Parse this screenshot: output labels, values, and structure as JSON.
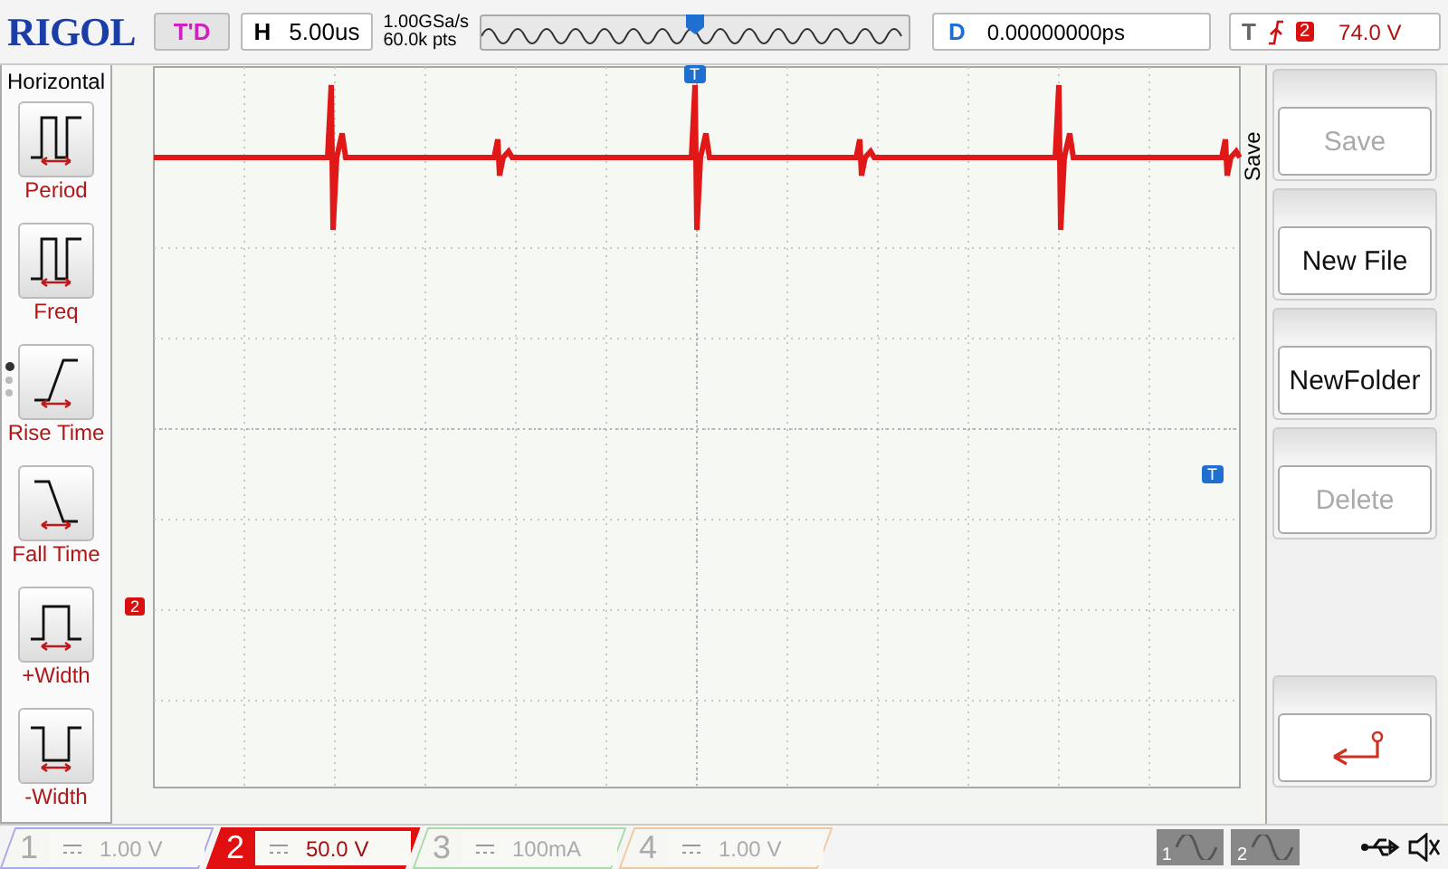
{
  "brand": "RIGOL",
  "run_status": "T'D",
  "horizontal": {
    "label": "H",
    "timebase": "5.00us",
    "sample_rate": "1.00GSa/s",
    "memory_depth": "60.0k pts"
  },
  "delay": {
    "label": "D",
    "value": "0.00000000ps"
  },
  "trigger": {
    "label": "T",
    "source": "2",
    "level": "74.0 V"
  },
  "measure_menu": {
    "title": "Horizontal",
    "items": [
      {
        "label": "Period",
        "kind": "period"
      },
      {
        "label": "Freq",
        "kind": "freq"
      },
      {
        "label": "Rise Time",
        "kind": "rise"
      },
      {
        "label": "Fall Time",
        "kind": "fall"
      },
      {
        "label": "+Width",
        "kind": "pwidth"
      },
      {
        "label": "-Width",
        "kind": "nwidth"
      }
    ],
    "page_dots": [
      {
        "selected": true
      },
      {
        "selected": false
      },
      {
        "selected": false
      }
    ]
  },
  "screen": {
    "trigger_position_marker": "T",
    "trigger_level_marker": "T",
    "channel_marker": "2"
  },
  "softkey_menu": {
    "title": "Save",
    "buttons": [
      {
        "kind": "text",
        "label": "Save",
        "disabled": true
      },
      {
        "kind": "text",
        "label": "New File",
        "disabled": false
      },
      {
        "kind": "text",
        "label": "NewFolder",
        "disabled": false
      },
      {
        "kind": "text",
        "label": "Delete",
        "disabled": true
      },
      {
        "kind": "back"
      }
    ]
  },
  "channels": [
    {
      "number": "1",
      "scale": "1.00 V",
      "selected": false,
      "color": "#a8a8e8"
    },
    {
      "number": "2",
      "scale": "50.0 V",
      "selected": true,
      "color": "#e01010"
    },
    {
      "number": "3",
      "scale": "100mA",
      "selected": false,
      "color": "#a8dca8"
    },
    {
      "number": "4",
      "scale": "1.00 V",
      "selected": false,
      "color": "#f0c8a0"
    }
  ],
  "math_sources": [
    {
      "number": "1"
    },
    {
      "number": "2"
    }
  ]
}
